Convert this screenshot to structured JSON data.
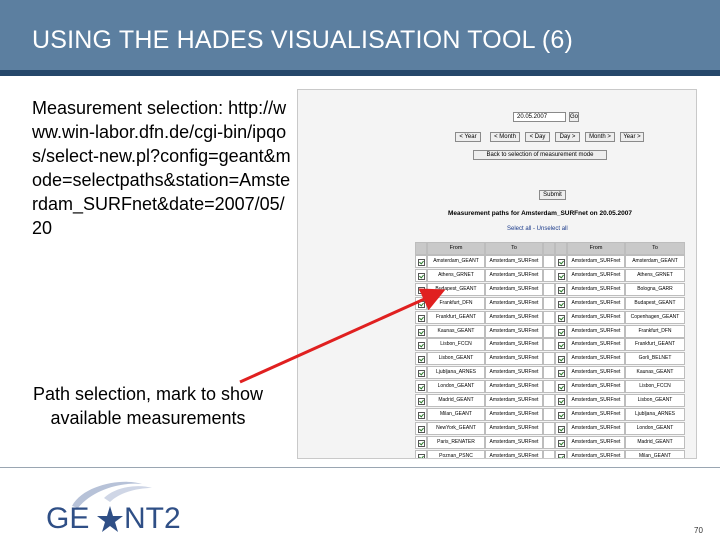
{
  "slide": {
    "title": "USING THE HADES VISUALISATION TOOL (6)",
    "left_text": "Measurement selection: http://www.win-labor.dfn.de/cgi-bin/ipqos/select-new.pl?config=geant&mode=selectpaths&station=Amsterdam_SURFnet&date=2007/05/20",
    "caption": "Path selection, mark to show available measurements",
    "page_number": "70",
    "logo_text": "GEANT2",
    "colors": {
      "title_bar": "#5c7fa0",
      "title_rule": "#26476a",
      "arrow": "#e02020"
    }
  },
  "screenshot": {
    "date_value": "20.05.2007",
    "go_label": "Go",
    "nav_buttons": [
      "< Year",
      "< Month",
      "< Day",
      "Day >",
      "Month >",
      "Year >"
    ],
    "back_button": "Back to selection of measurement mode",
    "submit_label": "Submit",
    "paths_title": "Measurement paths for Amsterdam_SURFnet on 20.05.2007",
    "select_links": "Select all - Unselect all",
    "table": {
      "headers": [
        "From",
        "To",
        "From",
        "To"
      ],
      "rows": [
        [
          "Amsterdam_GEANT",
          "Amsterdam_SURFnet",
          "Amsterdam_SURFnet",
          "Amsterdam_GEANT"
        ],
        [
          "Athens_GRNET",
          "Amsterdam_SURFnet",
          "Amsterdam_SURFnet",
          "Athens_GRNET"
        ],
        [
          "Budapest_GEANT",
          "Amsterdam_SURFnet",
          "Amsterdam_SURFnet",
          "Bologna_GARR"
        ],
        [
          "Frankfurt_DFN",
          "Amsterdam_SURFnet",
          "Amsterdam_SURFnet",
          "Budapest_GEANT"
        ],
        [
          "Frankfurt_GEANT",
          "Amsterdam_SURFnet",
          "Amsterdam_SURFnet",
          "Copenhagen_GEANT"
        ],
        [
          "Kaunas_GEANT",
          "Amsterdam_SURFnet",
          "Amsterdam_SURFnet",
          "Frankfurt_DFN"
        ],
        [
          "Lisbon_FCCN",
          "Amsterdam_SURFnet",
          "Amsterdam_SURFnet",
          "Frankfurt_GEANT"
        ],
        [
          "Lisbon_GEANT",
          "Amsterdam_SURFnet",
          "Amsterdam_SURFnet",
          "Gorli_BELNET"
        ],
        [
          "Ljubljana_ARNES",
          "Amsterdam_SURFnet",
          "Amsterdam_SURFnet",
          "Kaunas_GEANT"
        ],
        [
          "London_GEANT",
          "Amsterdam_SURFnet",
          "Amsterdam_SURFnet",
          "Lisbon_FCCN"
        ],
        [
          "Madrid_GEANT",
          "Amsterdam_SURFnet",
          "Amsterdam_SURFnet",
          "Lisbon_GEANT"
        ],
        [
          "Milan_GEANT",
          "Amsterdam_SURFnet",
          "Amsterdam_SURFnet",
          "Ljubljana_ARNES"
        ],
        [
          "NewYork_GEANT",
          "Amsterdam_SURFnet",
          "Amsterdam_SURFnet",
          "London_GEANT"
        ],
        [
          "Paris_RENATER",
          "Amsterdam_SURFnet",
          "Amsterdam_SURFnet",
          "Madrid_GEANT"
        ],
        [
          "Poznan_PSNC",
          "Amsterdam_SURFnet",
          "Amsterdam_SURFnet",
          "Milan_GEANT"
        ]
      ]
    }
  }
}
